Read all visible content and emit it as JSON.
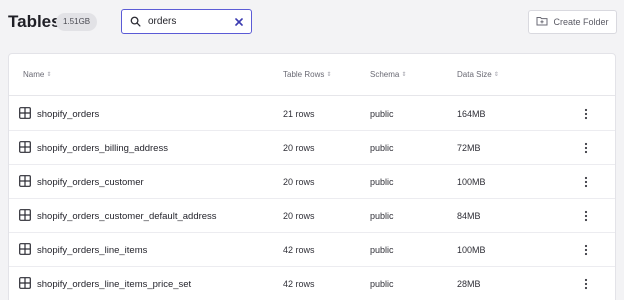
{
  "header": {
    "title": "Tables",
    "total_size": "1.51GB",
    "create_folder_label": "Create Folder"
  },
  "search": {
    "value": "orders",
    "placeholder": ""
  },
  "table": {
    "columns": [
      "Name",
      "Table Rows",
      "Schema",
      "Data Size"
    ],
    "rows": [
      {
        "name": "shopify_orders",
        "rows": "21 rows",
        "schema": "public",
        "size": "164MB"
      },
      {
        "name": "shopify_orders_billing_address",
        "rows": "20 rows",
        "schema": "public",
        "size": "72MB"
      },
      {
        "name": "shopify_orders_customer",
        "rows": "20 rows",
        "schema": "public",
        "size": "100MB"
      },
      {
        "name": "shopify_orders_customer_default_address",
        "rows": "20 rows",
        "schema": "public",
        "size": "84MB"
      },
      {
        "name": "shopify_orders_line_items",
        "rows": "42 rows",
        "schema": "public",
        "size": "100MB"
      },
      {
        "name": "shopify_orders_line_items_price_set",
        "rows": "42 rows",
        "schema": "public",
        "size": "28MB"
      }
    ]
  },
  "icons": {
    "search": "search-icon",
    "clear": "close-icon",
    "folder": "folder-plus-icon",
    "table": "table-grid-icon",
    "menu": "more-vertical-icon",
    "sort": "sort-icon"
  },
  "colors": {
    "accent": "#5b5bd6",
    "background": "#f3f3f5"
  }
}
